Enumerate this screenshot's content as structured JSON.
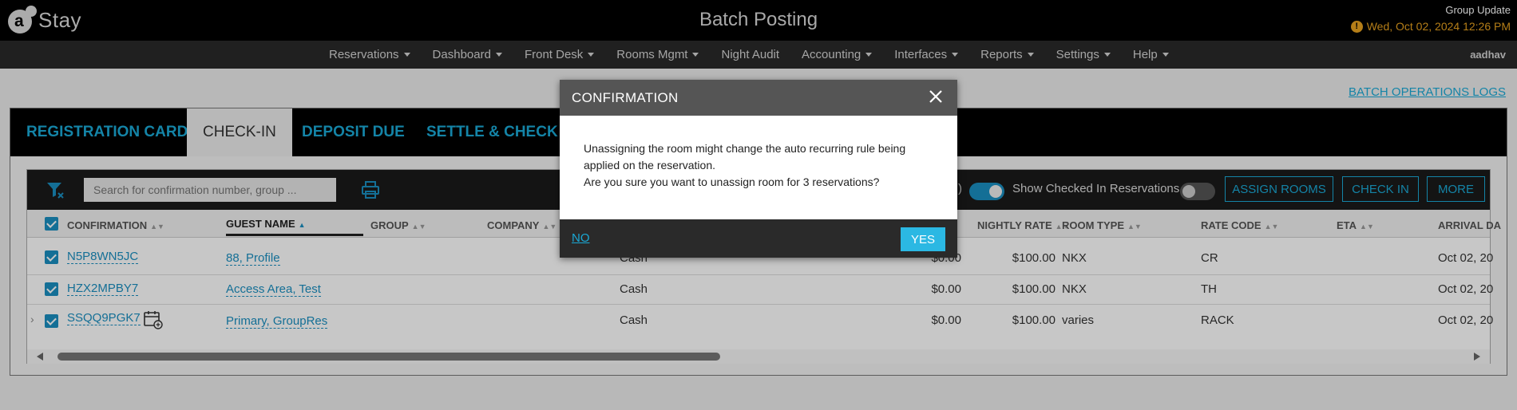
{
  "app": {
    "logo_text": "Stay",
    "logo_letter": "a",
    "page_title": "Batch Posting",
    "group_update": "Group Update",
    "datetime": "Wed, Oct 02, 2024 12:26 PM",
    "user": "aadhav"
  },
  "nav": {
    "items": [
      {
        "label": "Reservations",
        "dropdown": true
      },
      {
        "label": "Dashboard",
        "dropdown": true
      },
      {
        "label": "Front Desk",
        "dropdown": true
      },
      {
        "label": "Rooms Mgmt",
        "dropdown": true
      },
      {
        "label": "Night Audit",
        "dropdown": false
      },
      {
        "label": "Accounting",
        "dropdown": true
      },
      {
        "label": "Interfaces",
        "dropdown": true
      },
      {
        "label": "Reports",
        "dropdown": true
      },
      {
        "label": "Settings",
        "dropdown": true
      },
      {
        "label": "Help",
        "dropdown": true
      }
    ]
  },
  "page": {
    "batch_logs": "BATCH OPERATIONS LOGS",
    "tabs": [
      {
        "label": "REGISTRATION CARD",
        "active": false
      },
      {
        "label": "CHECK-IN",
        "active": true
      },
      {
        "label": "DEPOSIT DUE",
        "active": false
      },
      {
        "label": "SETTLE & CHECK OU",
        "active": false
      }
    ]
  },
  "toolbar": {
    "search_placeholder": "Search for confirmation number, group ...",
    "show_checked": "Show Checked In Reservations",
    "paren": ")",
    "assign_rooms": "ASSIGN ROOMS",
    "check_in": "CHECK IN",
    "more": "MORE"
  },
  "table": {
    "headers": {
      "confirmation": "CONFIRMATION",
      "guest_name": "GUEST NAME",
      "group": "GROUP",
      "company": "COMPANY",
      "nightly_rate": "NIGHTLY RATE",
      "room_type": "ROOM TYPE",
      "rate_code": "RATE CODE",
      "eta": "ETA",
      "arrival_date": "ARRIVAL DA"
    },
    "rows": [
      {
        "confirmation": "N5P8WN5JC",
        "guest": "88, Profile",
        "payment": "Cash",
        "balance": "$0.00",
        "rate": "$100.00",
        "room_type": "NKX",
        "rate_code": "CR",
        "arrival": "Oct 02, 20"
      },
      {
        "confirmation": "HZX2MPBY7",
        "guest": "Access Area, Test",
        "payment": "Cash",
        "balance": "$0.00",
        "rate": "$100.00",
        "room_type": "NKX",
        "rate_code": "TH",
        "arrival": "Oct 02, 20"
      },
      {
        "confirmation": "SSQQ9PGK7",
        "guest": "Primary, GroupRes",
        "payment": "Cash",
        "balance": "$0.00",
        "rate": "$100.00",
        "room_type": "varies",
        "rate_code": "RACK",
        "arrival": "Oct 02, 20"
      }
    ]
  },
  "modal": {
    "title": "CONFIRMATION",
    "line1": "Unassigning the room might change the auto recurring rule being applied on the reservation.",
    "line2": "Are you sure you want to unassign room for 3 reservations?",
    "no": "NO",
    "yes": "YES"
  },
  "colors": {
    "accent": "#1aa9d6",
    "header_bg": "#000000",
    "warning": "#e8a21f",
    "yes_button": "#2bb8e3"
  }
}
